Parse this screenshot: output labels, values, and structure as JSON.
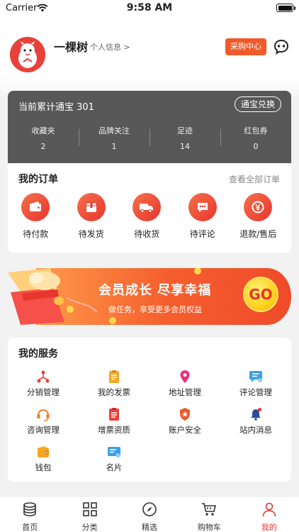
{
  "status_bar": {
    "carrier": "Carrier",
    "time": "9:58 AM"
  },
  "profile": {
    "name": "一棵树",
    "info_link": "个人信息 >",
    "purchase_center": "采购中心"
  },
  "treasure": {
    "label": "当前累计通宝 301",
    "exchange": "通宝兑换",
    "stats": [
      {
        "label": "收藏夹",
        "value": "2"
      },
      {
        "label": "品牌关注",
        "value": "1"
      },
      {
        "label": "足迹",
        "value": "14"
      },
      {
        "label": "红包券",
        "value": "0"
      }
    ]
  },
  "orders": {
    "title": "我的订单",
    "view_all": "查看全部订单",
    "items": [
      {
        "label": "待付款",
        "icon": "wallet-icon"
      },
      {
        "label": "待发货",
        "icon": "package-icon"
      },
      {
        "label": "待收货",
        "icon": "truck-icon"
      },
      {
        "label": "待评论",
        "icon": "comment-icon"
      },
      {
        "label": "退款/售后",
        "icon": "refund-icon"
      }
    ]
  },
  "banner": {
    "headline": "会员成长  尽享幸福",
    "subline": "做任务，享受更多会员权益",
    "go": "GO"
  },
  "services": {
    "title": "我的服务",
    "items": [
      {
        "label": "分销管理",
        "icon": "distribution-icon",
        "color": "#e8413a"
      },
      {
        "label": "我的发票",
        "icon": "invoice-icon",
        "color": "#f5a623"
      },
      {
        "label": "地址管理",
        "icon": "location-pin-icon",
        "color": "#e8307c"
      },
      {
        "label": "评论管理",
        "icon": "review-icon",
        "color": "#3aa0e8"
      },
      {
        "label": "咨询管理",
        "icon": "headset-icon",
        "color": "#f07a2a"
      },
      {
        "label": "增票资质",
        "icon": "certificate-icon",
        "color": "#e8413a"
      },
      {
        "label": "账户安全",
        "icon": "shield-icon",
        "color": "#f0592a"
      },
      {
        "label": "站内消息",
        "icon": "bell-icon",
        "color": "#2b4a9c"
      },
      {
        "label": "钱包",
        "icon": "wallet-small-icon",
        "color": "#f5a623"
      },
      {
        "label": "名片",
        "icon": "card-icon",
        "color": "#3aa0e8"
      }
    ]
  },
  "tabs": [
    {
      "label": "首页",
      "icon": "database-icon"
    },
    {
      "label": "分类",
      "icon": "grid-icon"
    },
    {
      "label": "精选",
      "icon": "compass-icon"
    },
    {
      "label": "购物车",
      "icon": "cart-icon"
    },
    {
      "label": "我的",
      "icon": "person-icon",
      "active": true
    }
  ],
  "colors": {
    "accent": "#e8352e",
    "card_dark": "#585858",
    "purchase": "#f15a2a"
  }
}
